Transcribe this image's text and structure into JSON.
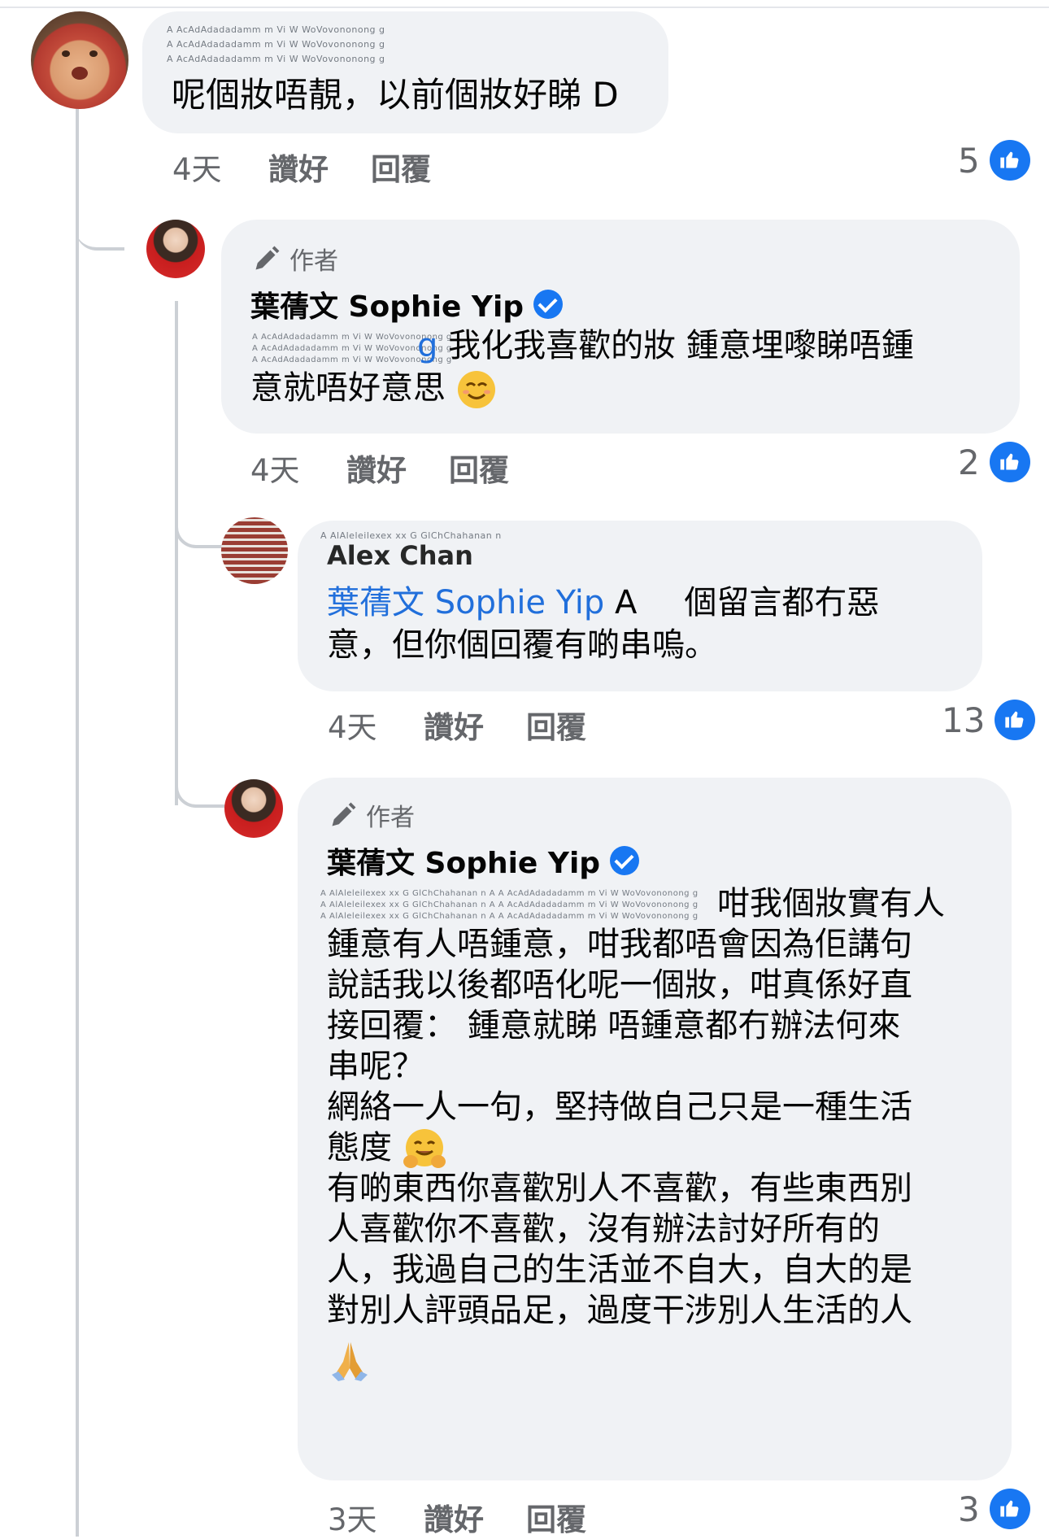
{
  "comments": [
    {
      "name_obscured": "A AcAdAdadadamm m Vi W WoVovononong g",
      "text": "呢個妝唔靚，以前個妝好睇 D",
      "time": "4天",
      "like_label": "讚好",
      "reply_label": "回覆",
      "reaction_count": "5"
    },
    {
      "author_tag": "作者",
      "name": "葉蒨文 Sophie Yip",
      "mention_visible": "g",
      "text_line1": "我化我喜歡的妝  鍾意埋嚟睇唔鍾",
      "text_line2": "意就唔好意思",
      "time": "4天",
      "like_label": "讚好",
      "reply_label": "回覆",
      "reaction_count": "2"
    },
    {
      "name": "Alex Chan",
      "mention": "葉蒨文 Sophie Yip",
      "mention_tail": "A",
      "text_line1": "個留言都冇惡",
      "text_line2": "意，但你個回覆有啲串嗚。",
      "time": "4天",
      "like_label": "讚好",
      "reply_label": "回覆",
      "reaction_count": "13"
    },
    {
      "author_tag": "作者",
      "name": "葉蒨文 Sophie Yip",
      "lines": [
        "咁我個妝實有人",
        "鍾意有人唔鍾意，咁我都唔會因為佢講句",
        "說話我以後都唔化呢一個妝，咁真係好直",
        "接回覆：  鍾意就睇 唔鍾意都冇辦法何來",
        "串呢？",
        "網絡一人一句，堅持做自己只是一種生活",
        "態度",
        "有啲東西你喜歡別人不喜歡，有些東西別",
        "人喜歡你不喜歡，沒有辦法討好所有的",
        "人，我過自己的生活並不自大，自大的是",
        "對別人評頭品足，過度干涉別人生活的人"
      ],
      "time": "3天",
      "like_label": "讚好",
      "reply_label": "回覆",
      "reaction_count": "3"
    }
  ]
}
